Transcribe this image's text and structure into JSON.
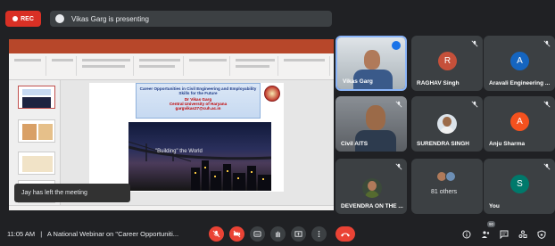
{
  "recording": {
    "label": "REC"
  },
  "presenter": {
    "text": "Vikas Garg is presenting"
  },
  "slide": {
    "title_line": "Career Opportunities in Civil Engineering and Employability Skills for the Future",
    "presenter_name": "Dr Vikas Garg",
    "affiliation": "Central University of Haryana",
    "email": "gargvikas27@cuh.ac.in",
    "photo_caption": "\"Building\" the World"
  },
  "toast": {
    "text": "Jay has left the meeting"
  },
  "tiles": {
    "vikas": {
      "name": "Vikas Garg"
    },
    "raghav": {
      "name": "RAGHAV Singh",
      "initial": "R",
      "color": "#c5503a"
    },
    "aravali": {
      "name": "Aravali Engineering ...",
      "initial": "A",
      "color": "#1565c0"
    },
    "civil": {
      "name": "Civil AITS"
    },
    "surendra": {
      "name": "SURENDRA SINGH"
    },
    "anju": {
      "name": "Anju Sharma",
      "initial": "A",
      "color": "#f4511e"
    },
    "devendra": {
      "name": "DEVENDRA ON THE ..."
    },
    "others": {
      "name": "81 others"
    },
    "you": {
      "name": "You",
      "initial": "S",
      "color": "#00796b"
    }
  },
  "bottom": {
    "time": "11:05 AM",
    "separator": "|",
    "meeting_title": "A National Webinar on \"Career Opportuniti...",
    "participants_count": "90"
  },
  "colors": {
    "hangup": "#ea4335",
    "accent": "#1a73e8"
  }
}
